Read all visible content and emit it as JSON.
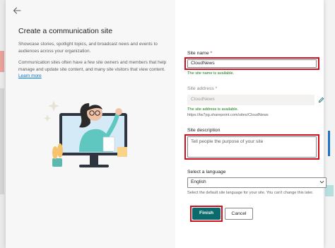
{
  "panel": {
    "back_icon": "arrow-left-icon",
    "title": "Create a communication site",
    "description_1": "Showcase stories, spotlight topics, and broadcast news and events to audiences across your organization.",
    "description_2": "Communication sites often have a few site owners and members that help manage and update site content, and many site visitors that view content.",
    "learn_more": "Learn more"
  },
  "form": {
    "site_name": {
      "label": "Site name",
      "required_mark": "*",
      "value": "CloudNews",
      "helper": "The site name is available."
    },
    "site_address": {
      "label": "Site address",
      "required_mark": "*",
      "value": "CloudNews",
      "helper_1": "The site address is available.",
      "helper_2": "https://tw7pg.sharepoint.com/sites/CloudNews",
      "edit_icon": "pencil-icon"
    },
    "site_description": {
      "label": "Site description",
      "placeholder": "Tell people the purpose of your site"
    },
    "language": {
      "label": "Select a language",
      "value": "English",
      "helper": "Select the default site language for your site. You can't change this later.",
      "arrow_icon": "chevron-down-icon"
    }
  },
  "buttons": {
    "finish": "Finish",
    "cancel": "Cancel"
  },
  "colors": {
    "primary": "#0b6a6c",
    "highlight": "#d0101e",
    "success": "#107c10",
    "link": "#0078d4"
  }
}
